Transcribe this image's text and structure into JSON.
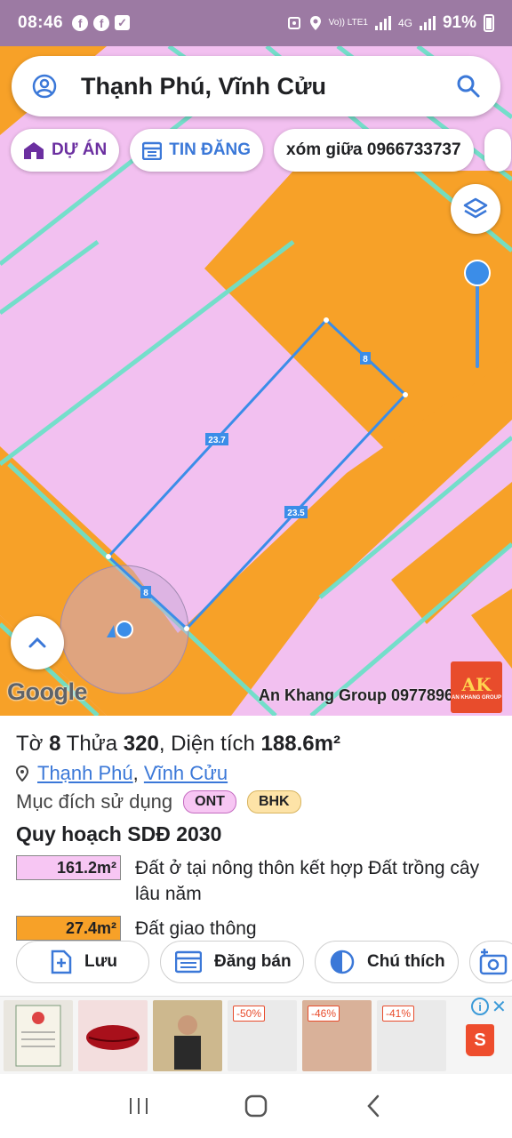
{
  "status_bar": {
    "time": "08:46",
    "network_label": "Vo)) LTE1",
    "network_type": "4G",
    "battery": "91%"
  },
  "search": {
    "title": "Thạnh Phú, Vĩnh Cửu",
    "user_icon": "user-circle-icon",
    "search_icon": "search-icon"
  },
  "chips": {
    "project": "DỰ ÁN",
    "listing": "TIN ĐĂNG",
    "note": "xóm giữa 0966733737"
  },
  "map": {
    "edge_labels": [
      "8",
      "23.7",
      "23.5",
      "8"
    ],
    "google_logo": "Google",
    "watermark": "An Khang Group 0977896",
    "logo_text": "AK",
    "logo_sub": "AN KHANG GROUP",
    "colors": {
      "residential": "#f2c0f0",
      "road": "#f7a128",
      "grid": "#6ee0c8",
      "parcel": "#3b8de8"
    }
  },
  "parcel": {
    "sheet_label": "Tờ",
    "sheet_no": "8",
    "lot_label": "Thửa",
    "lot_no": "320",
    "area_label": "Diện tích",
    "area": "188.6m²",
    "ward": "Thạnh Phú",
    "district": "Vĩnh Cửu",
    "purpose_label": "Mục đích sử dụng",
    "purpose_badges": [
      "ONT",
      "BHK"
    ]
  },
  "plan": {
    "title": "Quy hoạch SDĐ 2030",
    "rows": [
      {
        "area": "161.2m²",
        "color": "#f7c6f3",
        "label": "Đất ở tại nông thôn kết hợp Đất trồng cây lâu năm"
      },
      {
        "area": "27.4m²",
        "color": "#f7a128",
        "label": "Đất giao thông"
      }
    ]
  },
  "actions": {
    "save": "Lưu",
    "post": "Đăng bán",
    "legend": "Chú thích"
  },
  "ads": {
    "discounts": [
      "-50%",
      "-46%",
      "-41%"
    ],
    "shop_icon": "shopee-bag-icon"
  }
}
